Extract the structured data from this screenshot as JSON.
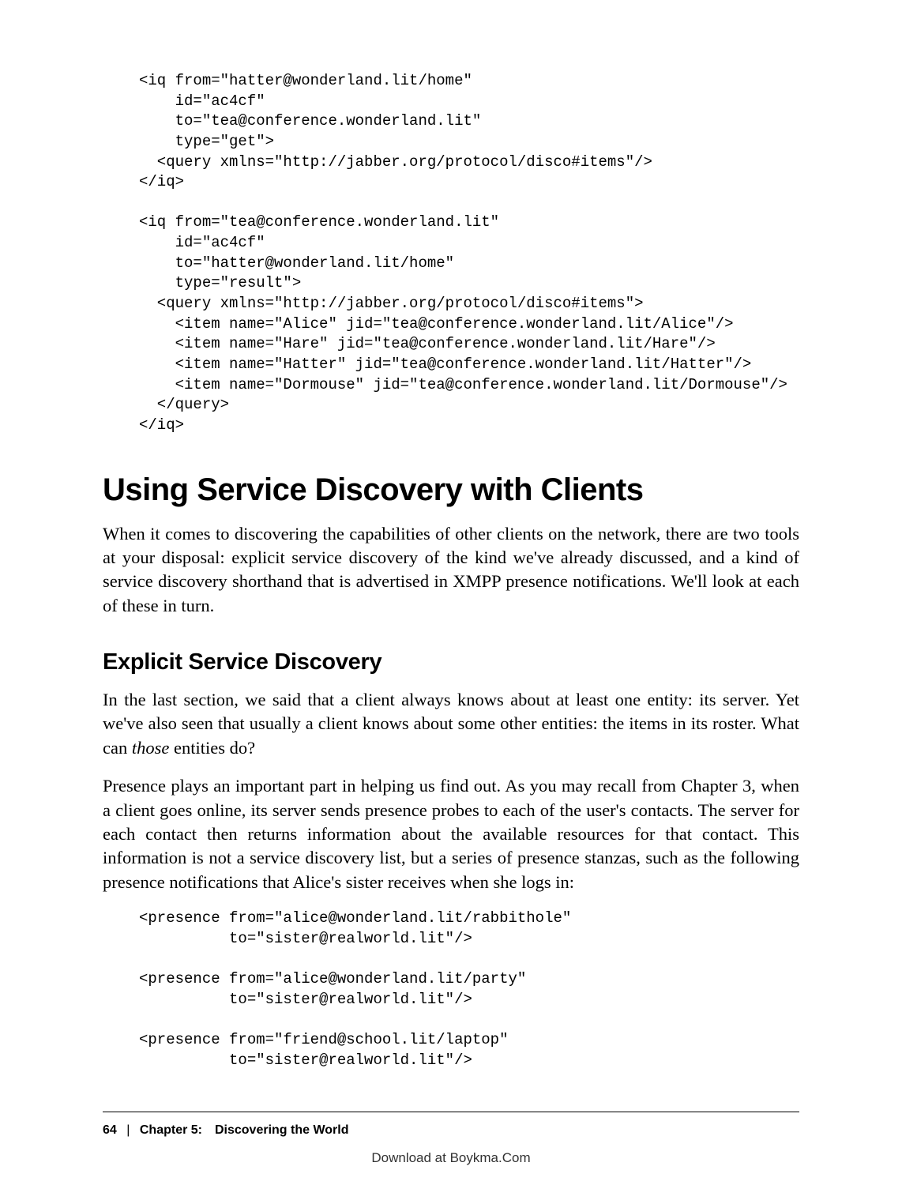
{
  "code1": "<iq from=\"hatter@wonderland.lit/home\"\n    id=\"ac4cf\"\n    to=\"tea@conference.wonderland.lit\"\n    type=\"get\">\n  <query xmlns=\"http://jabber.org/protocol/disco#items\"/>\n</iq>\n\n<iq from=\"tea@conference.wonderland.lit\"\n    id=\"ac4cf\"\n    to=\"hatter@wonderland.lit/home\"\n    type=\"result\">\n  <query xmlns=\"http://jabber.org/protocol/disco#items\">\n    <item name=\"Alice\" jid=\"tea@conference.wonderland.lit/Alice\"/>\n    <item name=\"Hare\" jid=\"tea@conference.wonderland.lit/Hare\"/>\n    <item name=\"Hatter\" jid=\"tea@conference.wonderland.lit/Hatter\"/>\n    <item name=\"Dormouse\" jid=\"tea@conference.wonderland.lit/Dormouse\"/>\n  </query>\n</iq>",
  "h1": "Using Service Discovery with Clients",
  "p1": "When it comes to discovering the capabilities of other clients on the network, there are two tools at your disposal: explicit service discovery of the kind we've already discussed, and a kind of service discovery shorthand that is advertised in XMPP presence notifications. We'll look at each of these in turn.",
  "h2": "Explicit Service Discovery",
  "p2a": "In the last section, we said that a client always knows about at least one entity: its server. Yet we've also seen that usually a client knows about some other entities: the items in its roster. What can ",
  "p2em": "those",
  "p2b": " entities do?",
  "p3": "Presence plays an important part in helping us find out. As you may recall from Chapter 3, when a client goes online, its server sends presence probes to each of the user's contacts. The server for each contact then returns information about the available resources for that contact. This information is not a service discovery list, but a series of presence stanzas, such as the following presence notifications that Alice's sister receives when she logs in:",
  "code2": "<presence from=\"alice@wonderland.lit/rabbithole\"\n          to=\"sister@realworld.lit\"/>\n\n<presence from=\"alice@wonderland.lit/party\"\n          to=\"sister@realworld.lit\"/>\n\n<presence from=\"friend@school.lit/laptop\"\n          to=\"sister@realworld.lit\"/>",
  "footer": {
    "page": "64",
    "sep": "|",
    "chapter": "Chapter 5: Discovering the World"
  },
  "download": "Download at Boykma.Com"
}
